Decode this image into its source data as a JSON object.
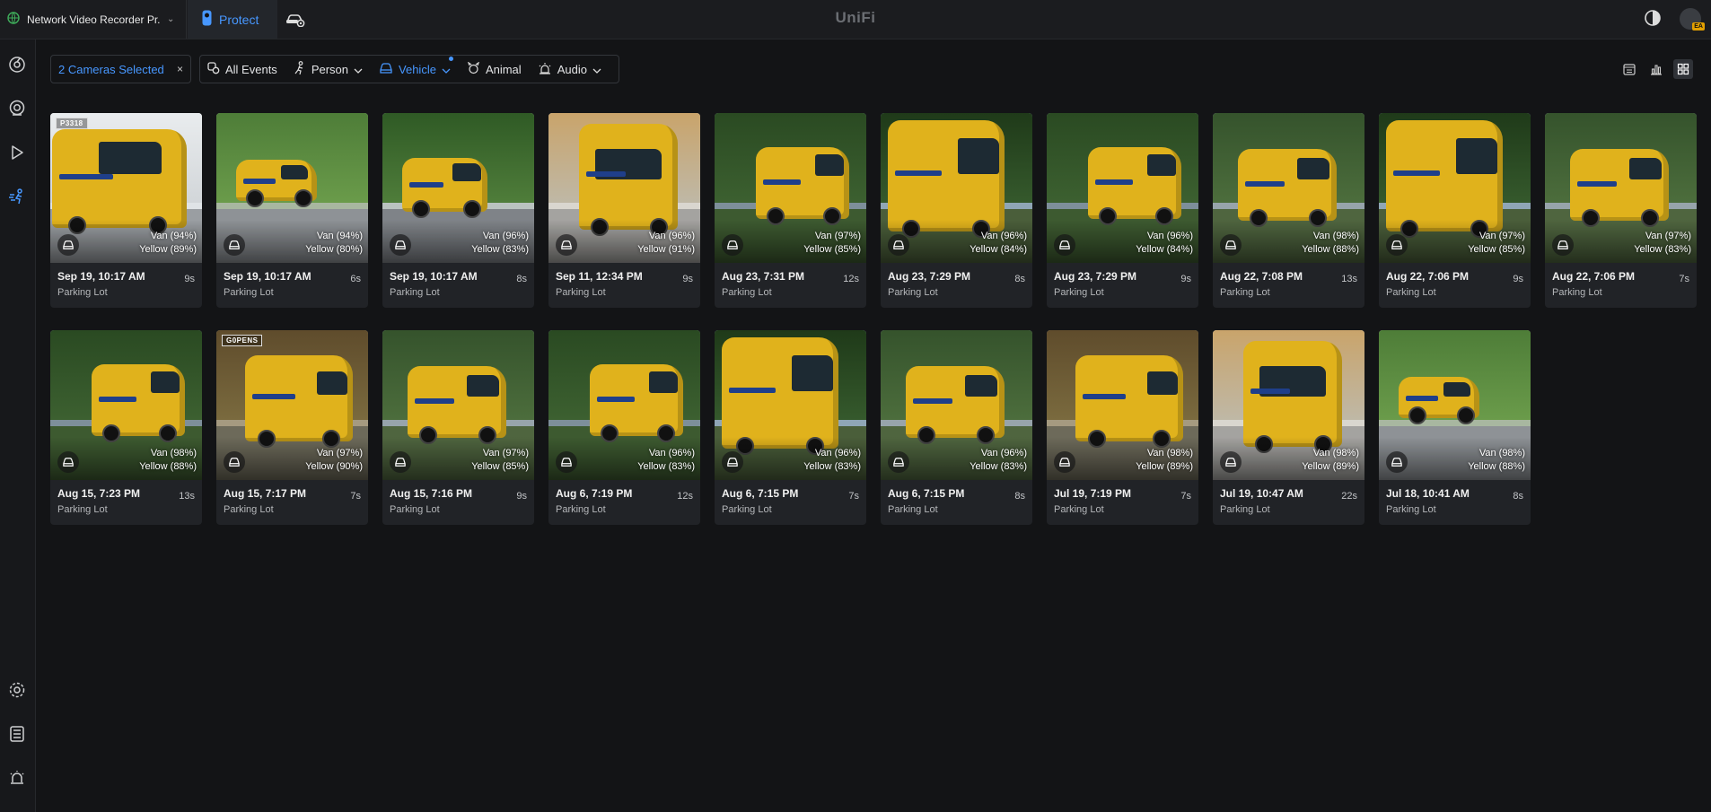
{
  "topbar": {
    "app_name": "Network Video Recorder Pr...",
    "protect_tab": "Protect",
    "brand": "UniFi",
    "avatar_badge": "EA",
    "accent_color": "#4797ff"
  },
  "filters": {
    "cameras_selected": "2 Cameras Selected",
    "clear_symbol": "×",
    "all_events": "All Events",
    "person": "Person",
    "vehicle": "Vehicle",
    "animal": "Animal",
    "audio": "Audio"
  },
  "events": [
    {
      "time": "Sep 19, 10:17 AM",
      "location": "Parking Lot",
      "duration": "9s",
      "type": "Van (94%)",
      "color": "Yellow (89%)",
      "tag": "P3318",
      "scene": 0
    },
    {
      "time": "Sep 19, 10:17 AM",
      "location": "Parking Lot",
      "duration": "6s",
      "type": "Van (94%)",
      "color": "Yellow (80%)",
      "tag": "",
      "scene": 1
    },
    {
      "time": "Sep 19, 10:17 AM",
      "location": "Parking Lot",
      "duration": "8s",
      "type": "Van (96%)",
      "color": "Yellow (83%)",
      "tag": "",
      "scene": 2
    },
    {
      "time": "Sep 11, 12:34 PM",
      "location": "Parking Lot",
      "duration": "9s",
      "type": "Van (96%)",
      "color": "Yellow (91%)",
      "tag": "",
      "scene": 3
    },
    {
      "time": "Aug 23, 7:31 PM",
      "location": "Parking Lot",
      "duration": "12s",
      "type": "Van (97%)",
      "color": "Yellow (85%)",
      "tag": "",
      "scene": 4
    },
    {
      "time": "Aug 23, 7:29 PM",
      "location": "Parking Lot",
      "duration": "8s",
      "type": "Van (96%)",
      "color": "Yellow (84%)",
      "tag": "",
      "scene": 5
    },
    {
      "time": "Aug 23, 7:29 PM",
      "location": "Parking Lot",
      "duration": "9s",
      "type": "Van (96%)",
      "color": "Yellow (84%)",
      "tag": "",
      "scene": 4
    },
    {
      "time": "Aug 22, 7:08 PM",
      "location": "Parking Lot",
      "duration": "13s",
      "type": "Van (98%)",
      "color": "Yellow (88%)",
      "tag": "",
      "scene": 6
    },
    {
      "time": "Aug 22, 7:06 PM",
      "location": "Parking Lot",
      "duration": "9s",
      "type": "Van (97%)",
      "color": "Yellow (85%)",
      "tag": "",
      "scene": 5
    },
    {
      "time": "Aug 22, 7:06 PM",
      "location": "Parking Lot",
      "duration": "7s",
      "type": "Van (97%)",
      "color": "Yellow (83%)",
      "tag": "",
      "scene": 6
    },
    {
      "time": "Aug 15, 7:23 PM",
      "location": "Parking Lot",
      "duration": "13s",
      "type": "Van (98%)",
      "color": "Yellow (88%)",
      "tag": "",
      "scene": 4
    },
    {
      "time": "Aug 15, 7:17 PM",
      "location": "Parking Lot",
      "duration": "7s",
      "type": "Van (97%)",
      "color": "Yellow (90%)",
      "tag": "G0PENS",
      "scene": 7
    },
    {
      "time": "Aug 15, 7:16 PM",
      "location": "Parking Lot",
      "duration": "9s",
      "type": "Van (97%)",
      "color": "Yellow (85%)",
      "tag": "",
      "scene": 6
    },
    {
      "time": "Aug 6, 7:19 PM",
      "location": "Parking Lot",
      "duration": "12s",
      "type": "Van (96%)",
      "color": "Yellow (83%)",
      "tag": "",
      "scene": 4
    },
    {
      "time": "Aug 6, 7:15 PM",
      "location": "Parking Lot",
      "duration": "7s",
      "type": "Van (96%)",
      "color": "Yellow (83%)",
      "tag": "",
      "scene": 5
    },
    {
      "time": "Aug 6, 7:15 PM",
      "location": "Parking Lot",
      "duration": "8s",
      "type": "Van (96%)",
      "color": "Yellow (83%)",
      "tag": "",
      "scene": 6
    },
    {
      "time": "Jul 19, 7:19 PM",
      "location": "Parking Lot",
      "duration": "7s",
      "type": "Van (98%)",
      "color": "Yellow (89%)",
      "tag": "",
      "scene": 7
    },
    {
      "time": "Jul 19, 10:47 AM",
      "location": "Parking Lot",
      "duration": "22s",
      "type": "Van (98%)",
      "color": "Yellow (89%)",
      "tag": "",
      "scene": 3
    },
    {
      "time": "Jul 18, 10:41 AM",
      "location": "Parking Lot",
      "duration": "8s",
      "type": "Van (98%)",
      "color": "Yellow (88%)",
      "tag": "",
      "scene": 1
    }
  ]
}
